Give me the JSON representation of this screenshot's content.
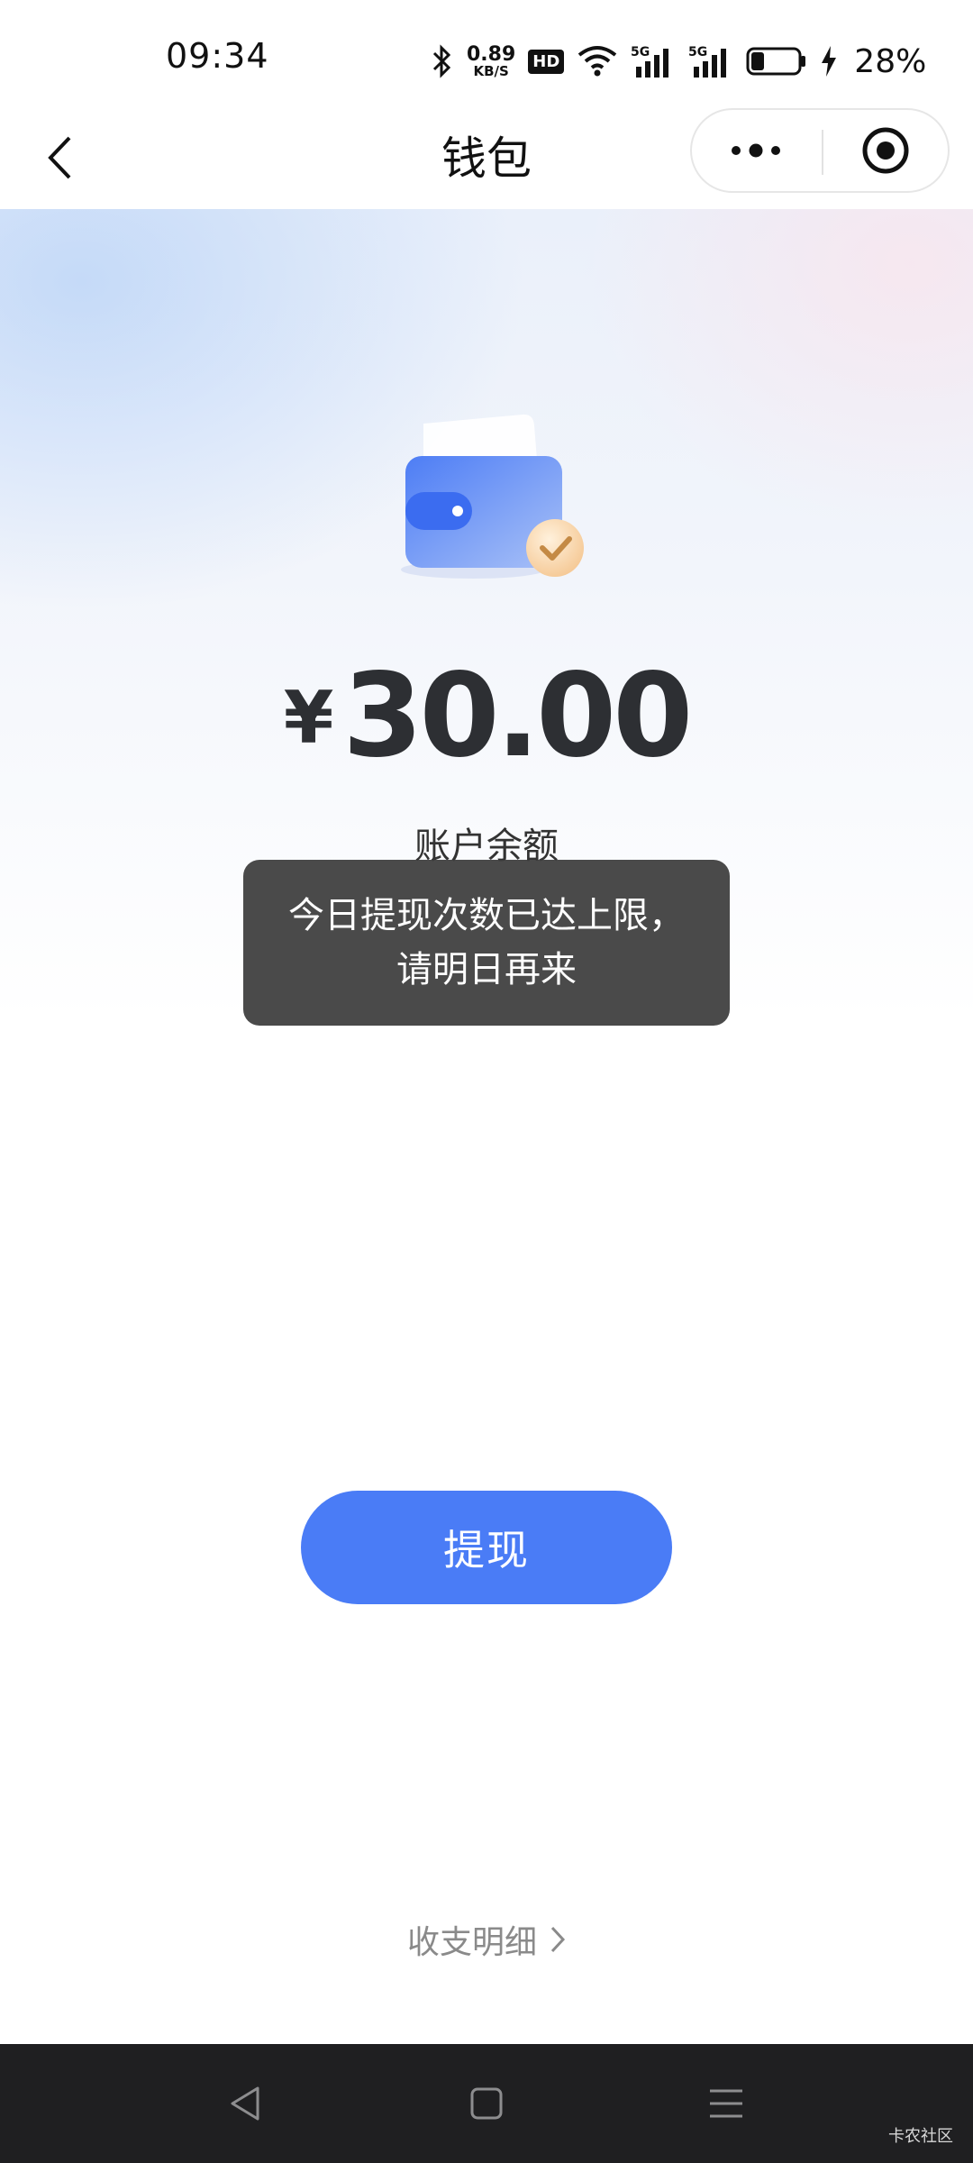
{
  "status_bar": {
    "time": "09:34",
    "net_speed_value": "0.89",
    "net_speed_unit": "KB/S",
    "hd_label": "HD",
    "signal_1": "5G",
    "signal_2": "5G",
    "battery_percent": "28%",
    "battery_level": 0.28
  },
  "nav": {
    "title": "钱包",
    "back_icon": "chevron-left-icon",
    "more_icon": "more-dots-icon",
    "close_icon": "target-circle-icon"
  },
  "wallet": {
    "currency_symbol": "¥",
    "balance": "30.00",
    "balance_label": "账户余额"
  },
  "toast": {
    "message": "今日提现次数已达上限，请明日再来"
  },
  "actions": {
    "withdraw_label": "提现",
    "details_label": "收支明细"
  },
  "system_nav": {
    "back_icon": "triangle-back-icon",
    "home_icon": "square-home-icon",
    "menu_icon": "menu-lines-icon"
  },
  "watermark": "卡农社区",
  "colors": {
    "accent": "#4a7cf6",
    "toast_bg": "#3c3c3c",
    "nav_bar_bg": "#1f1f21"
  }
}
